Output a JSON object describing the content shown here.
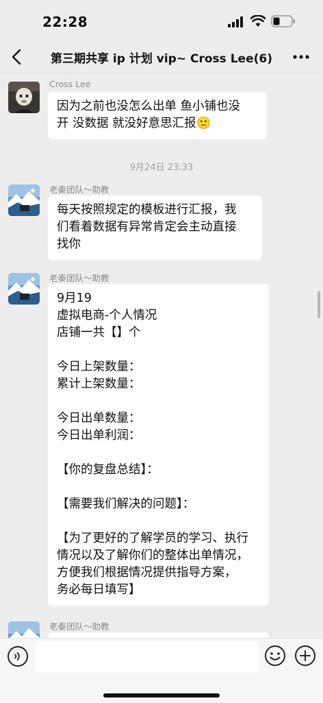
{
  "status": {
    "time": "22:28"
  },
  "header": {
    "title": "第三期共享 ip 计划 vip~ Cross Lee(6)"
  },
  "messages": [
    {
      "sender": "Cross Lee",
      "lines": [
        "因为之前也没怎么出单 鱼小铺也没",
        "开 没数据 就没好意思汇报🙁"
      ]
    },
    {
      "timestamp": "9月24日 23:33"
    },
    {
      "sender": "老秦团队～助教",
      "lines": [
        "每天按照规定的模板进行汇报，我",
        "们看着数据有异常肯定会主动直接",
        "找你"
      ]
    },
    {
      "sender": "老秦团队～助教",
      "lines": [
        "9月19",
        "虚拟电商-个人情况",
        "店铺一共【】个",
        "",
        "今日上架数量：",
        "累计上架数量：",
        "",
        "今日出单数量：",
        "今日出单利润：",
        "",
        "【你的复盘总结】：",
        "",
        "【需要我们解决的问题】：",
        "",
        "【为了更好的了解学员的学习、执行",
        "情况以及了解你们的整体出单情况，",
        "方便我们根据情况提供指导方案，",
        "务必每日填写】"
      ]
    },
    {
      "sender": "老秦团队～助教"
    }
  ],
  "input": {
    "placeholder": ""
  }
}
